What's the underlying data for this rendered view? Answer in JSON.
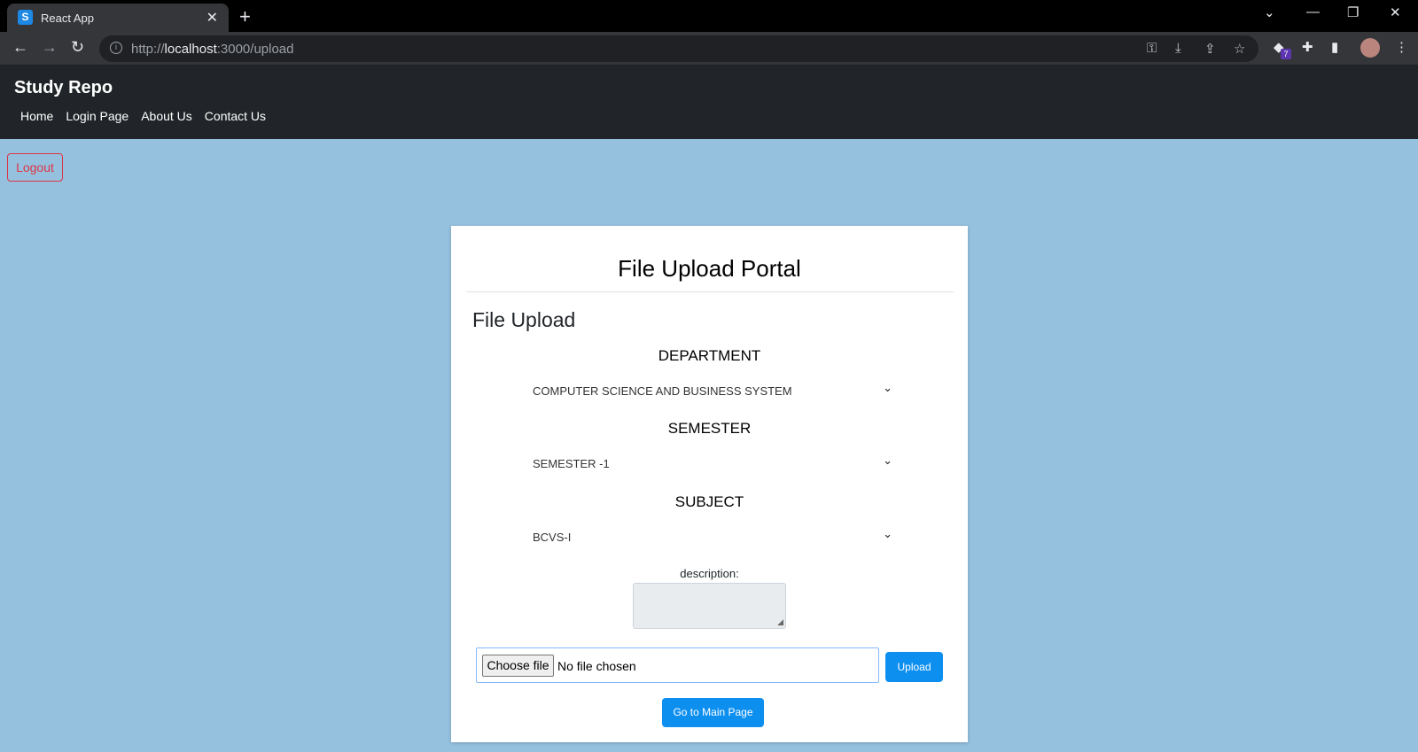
{
  "browser": {
    "tab_title": "React App",
    "tab_favicon_letter": "S",
    "url_scheme": "http://",
    "url_host": "localhost",
    "url_rest": ":3000/upload",
    "extension_badge": "7"
  },
  "app": {
    "brand": "Study Repo",
    "nav": [
      "Home",
      "Login Page",
      "About Us",
      "Contact Us"
    ],
    "logout_label": "Logout"
  },
  "card": {
    "title": "File Upload Portal",
    "section_title": "File Upload",
    "department_label": "DEPARTMENT",
    "department_value": "COMPUTER SCIENCE AND BUSINESS SYSTEM",
    "semester_label": "SEMESTER",
    "semester_value": "SEMESTER -1",
    "subject_label": "SUBJECT",
    "subject_value": "BCVS-I",
    "description_label": "description:",
    "choose_file_label": "Choose file",
    "no_file_text": "No file chosen",
    "upload_label": "Upload",
    "main_page_label": "Go to Main Page"
  },
  "colors": {
    "page_bg": "#95c1df",
    "navbar_bg": "#212529",
    "primary": "#0d8ff0",
    "danger": "#dc3545"
  }
}
